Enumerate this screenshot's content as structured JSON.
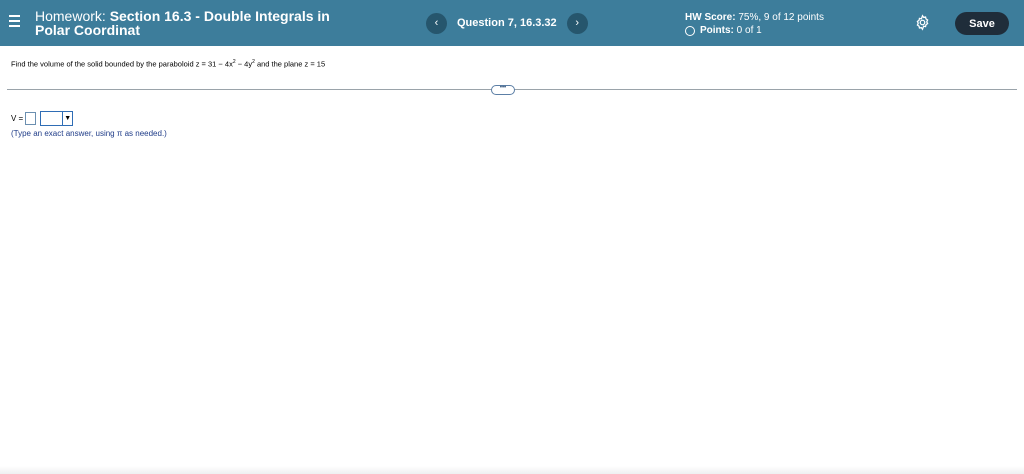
{
  "header": {
    "title_prefix": "Homework:",
    "title_main": "Section 16.3 - Double Integrals in",
    "title_line2": "Polar Coordinat",
    "question_label": "Question 7, 16.3.32",
    "prev_icon": "chevron-left-icon",
    "next_icon": "chevron-right-icon",
    "hw_score_label": "HW Score:",
    "hw_score_value": "75%, 9 of 12 points",
    "points_label": "Points:",
    "points_value": "0 of 1",
    "save_label": "Save"
  },
  "question": {
    "text_before": "Find the volume of the solid bounded by the paraboloid z = 31 − 4x",
    "exp1": "2",
    "text_mid": " − 4y",
    "exp2": "2",
    "text_after": " and the plane z = 15"
  },
  "more_label": "•••",
  "answer": {
    "label": "V =",
    "dropdown_arrow": "▼",
    "hint": "(Type an exact answer, using π as needed.)"
  },
  "colors": {
    "header_bg": "#3d7d9b",
    "nav_button": "#26566d",
    "save_button": "#1f2d3a"
  }
}
